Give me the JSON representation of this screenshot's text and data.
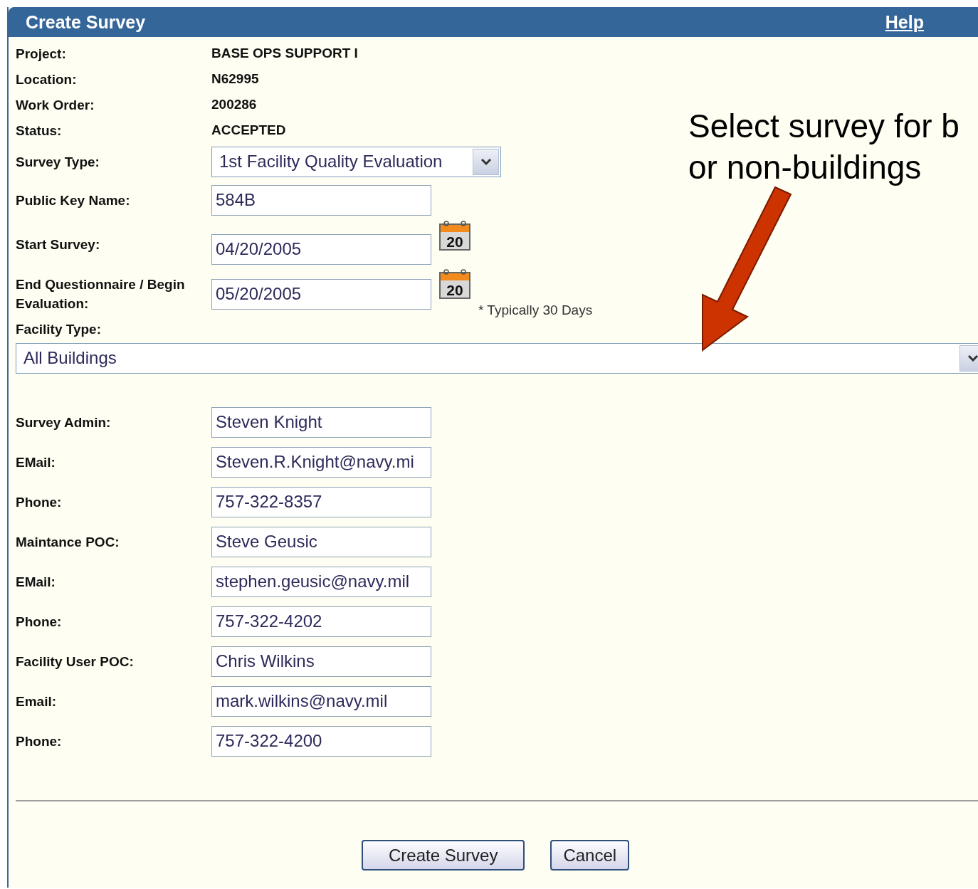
{
  "panel": {
    "title": "Create Survey",
    "help_link": "Help"
  },
  "info": [
    {
      "label": "Project:",
      "value": "BASE OPS SUPPORT I"
    },
    {
      "label": "Location:",
      "value": "N62995"
    },
    {
      "label": "Work Order:",
      "value": "200286"
    },
    {
      "label": "Status:",
      "value": "ACCEPTED"
    }
  ],
  "survey_type": {
    "label": "Survey Type:",
    "value": "1st Facility Quality Evaluation"
  },
  "public_key": {
    "label": "Public Key Name:",
    "value": "584B"
  },
  "dates": [
    {
      "label": "Start Survey:",
      "value": "04/20/2005",
      "calendar_day": "20"
    },
    {
      "label": "End Questionnaire / Begin Evaluation:",
      "value": "05/20/2005",
      "calendar_day": "20",
      "note": "* Typically 30 Days"
    }
  ],
  "facility_type": {
    "label": "Facility Type:",
    "value": "All Buildings"
  },
  "contacts": [
    {
      "label": "Survey Admin:",
      "value": "Steven Knight"
    },
    {
      "label": "EMail:",
      "value": "Steven.R.Knight@navy.mi"
    },
    {
      "label": "Phone:",
      "value": "757-322-8357"
    },
    {
      "label": "Maintance POC:",
      "value": "Steve Geusic"
    },
    {
      "label": "EMail:",
      "value": "stephen.geusic@navy.mil"
    },
    {
      "label": "Phone:",
      "value": "757-322-4202"
    },
    {
      "label": "Facility User POC:",
      "value": "Chris Wilkins"
    },
    {
      "label": "Email:",
      "value": "mark.wilkins@navy.mil"
    },
    {
      "label": "Phone:",
      "value": "757-322-4200"
    }
  ],
  "buttons": [
    "Create Survey",
    "Cancel"
  ],
  "annotation": {
    "lines": [
      "Select survey for b",
      "or non-buildings"
    ]
  }
}
